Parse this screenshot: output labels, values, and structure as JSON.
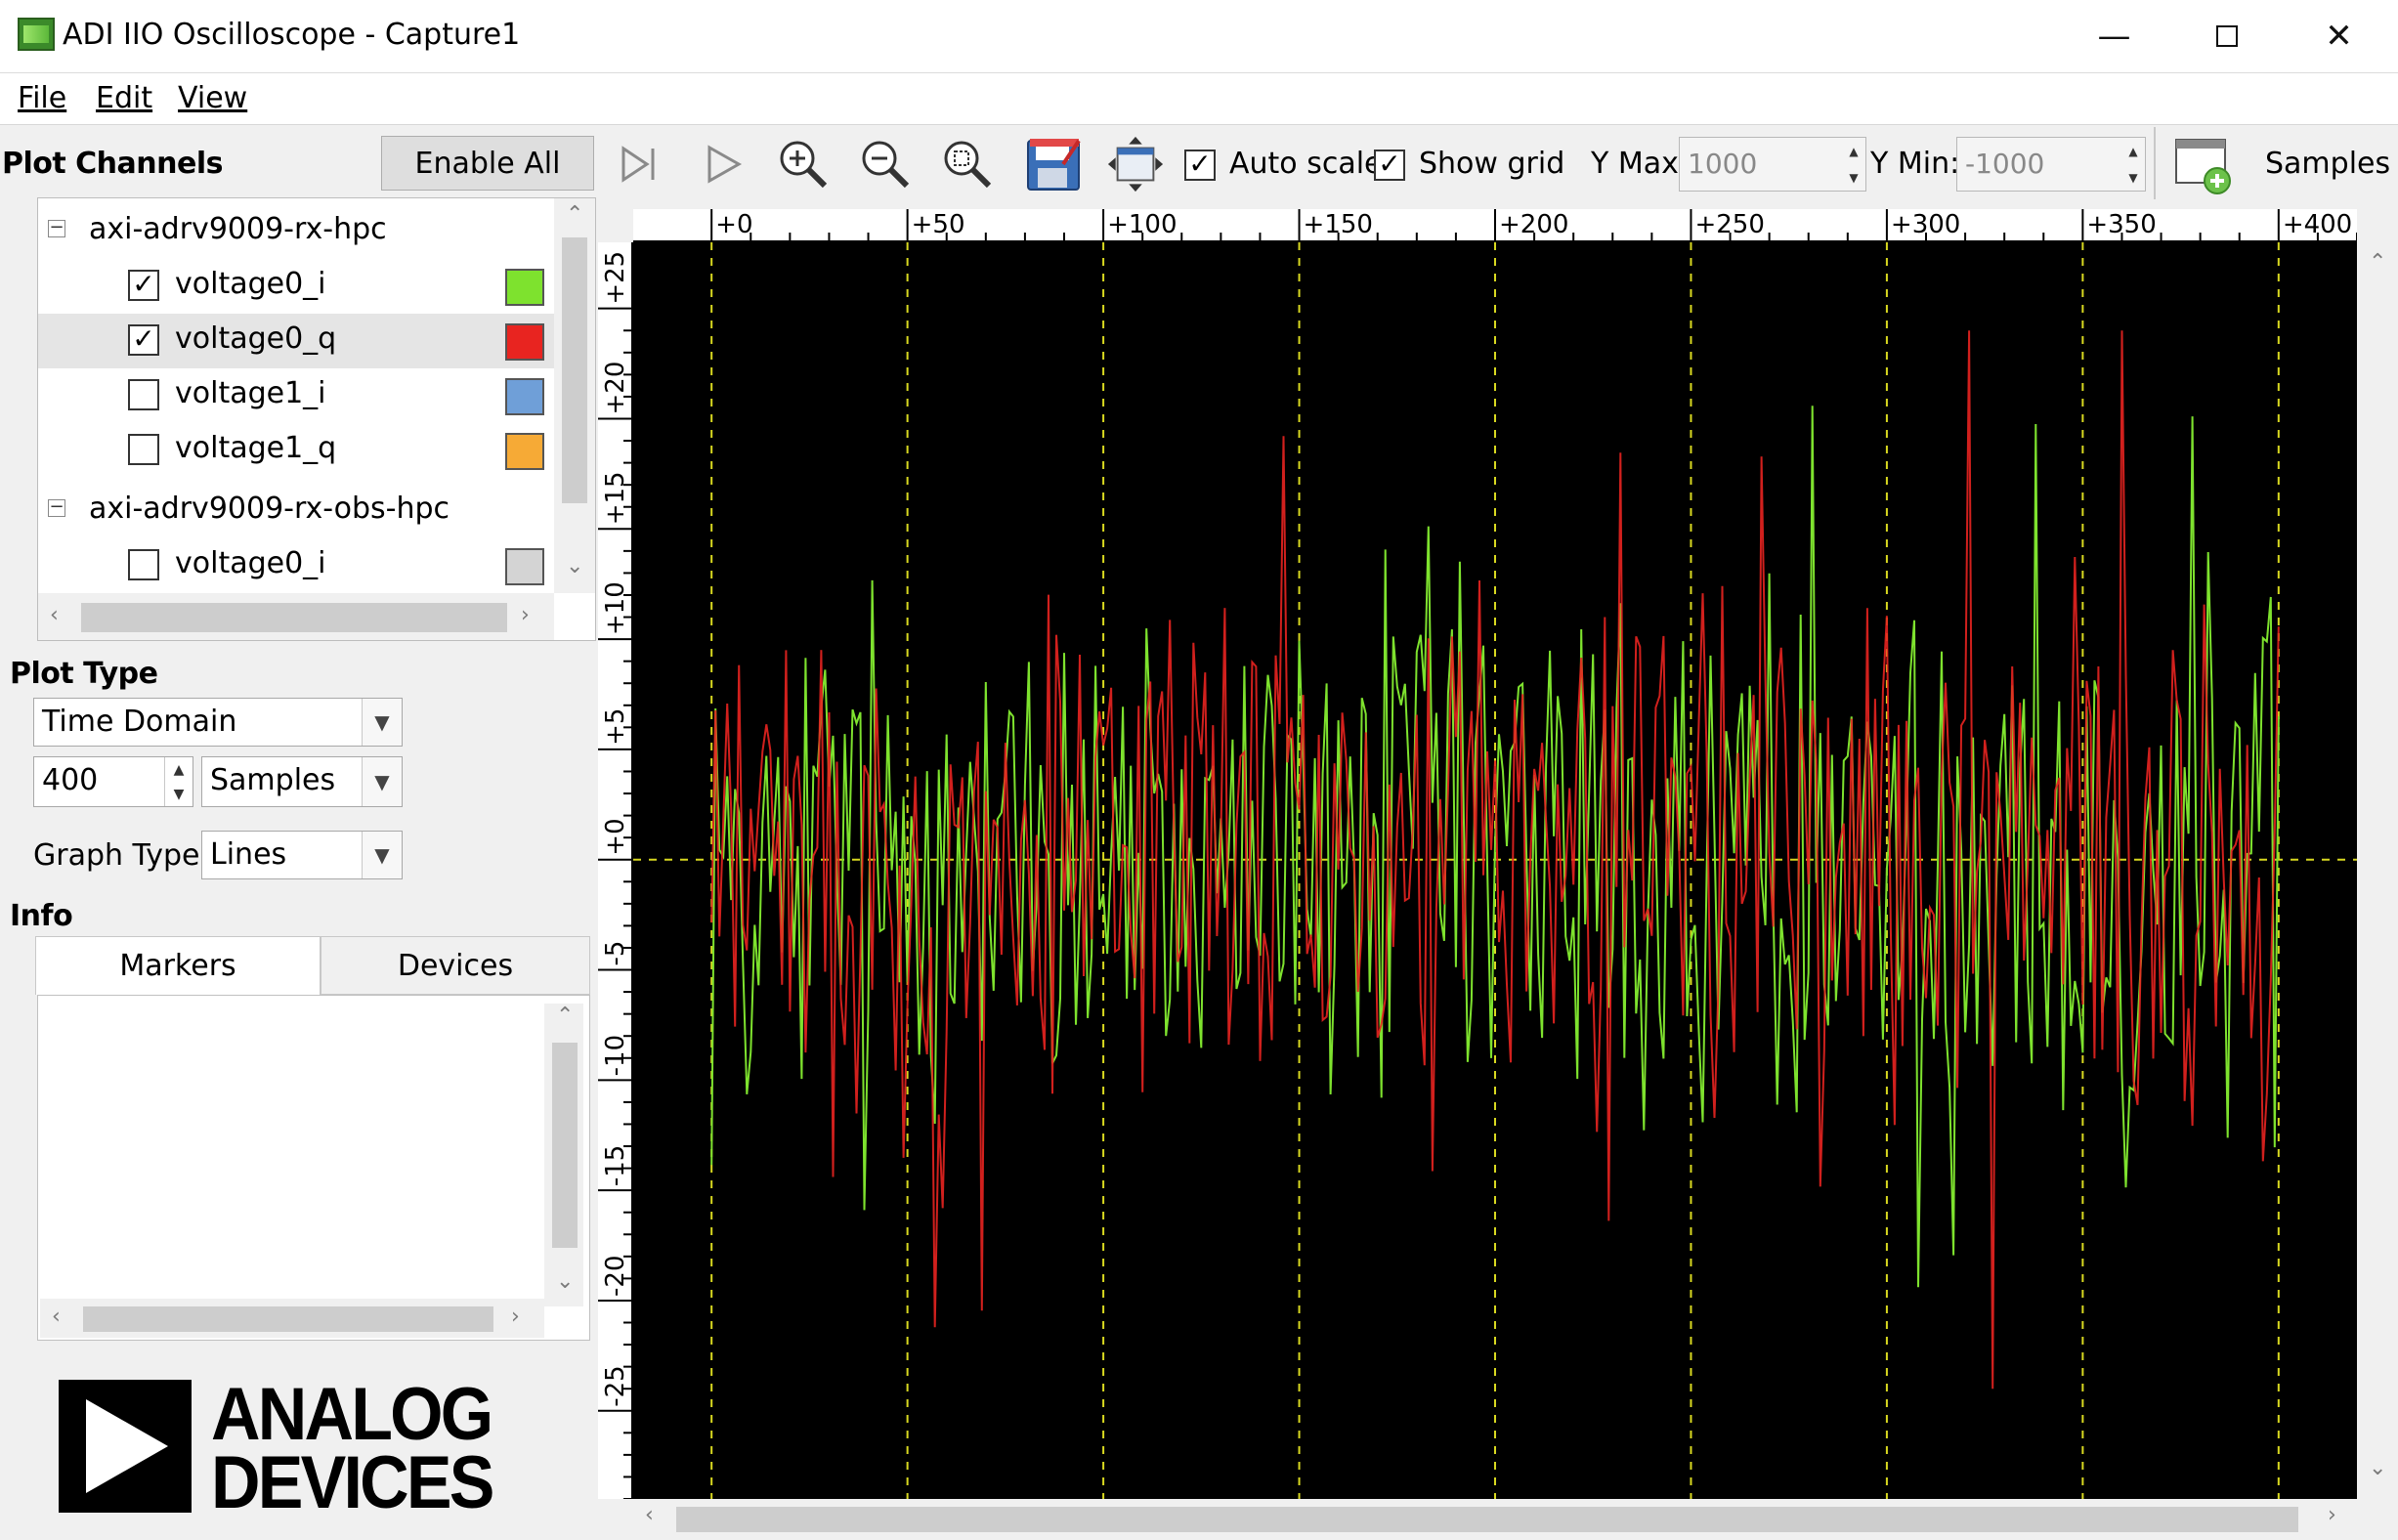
{
  "window": {
    "title": "ADI IIO Oscilloscope - Capture1"
  },
  "menu": {
    "file": "File",
    "edit": "Edit",
    "view": "View"
  },
  "left_panel": {
    "plot_channels_label": "Plot Channels",
    "enable_all_label": "Enable All",
    "devices": [
      {
        "name": "axi-adrv9009-rx-hpc",
        "channels": [
          {
            "name": "voltage0_i",
            "checked": true,
            "color": "#7ee22e"
          },
          {
            "name": "voltage0_q",
            "checked": true,
            "color": "#e82420"
          },
          {
            "name": "voltage1_i",
            "checked": false,
            "color": "#6f9fd8"
          },
          {
            "name": "voltage1_q",
            "checked": false,
            "color": "#f6aa36"
          }
        ]
      },
      {
        "name": "axi-adrv9009-rx-obs-hpc",
        "channels": [
          {
            "name": "voltage0_i",
            "checked": false,
            "color": "#d4d4d4"
          }
        ]
      }
    ],
    "plot_type_label": "Plot Type",
    "plot_type_value": "Time Domain",
    "sample_count": "400",
    "sample_unit": "Samples",
    "graph_type_label": "Graph Type:",
    "graph_type_value": "Lines",
    "info_label": "Info",
    "tabs": [
      "Markers",
      "Devices"
    ],
    "logo_line1": "ANALOG",
    "logo_line2": "DEVICES"
  },
  "toolbar": {
    "auto_scale_label": "Auto scale",
    "auto_scale_checked": true,
    "show_grid_label": "Show grid",
    "show_grid_checked": true,
    "ymax_label": "Y Max:",
    "ymax_value": "1000",
    "ymin_label": "Y Min:",
    "ymin_value": "-1000",
    "samples_label": "Samples",
    "icons": [
      "step-icon",
      "play-icon",
      "zoom-in-icon",
      "zoom-out-icon",
      "zoom-fit-icon",
      "save-icon",
      "fullscreen-icon",
      "add-plot-icon"
    ]
  },
  "chart_data": {
    "type": "line",
    "x_ticks": [
      "+0",
      "+50",
      "+100",
      "+150",
      "+200",
      "+250",
      "+300",
      "+350",
      "+400"
    ],
    "y_ticks": [
      "+25",
      "+20",
      "+15",
      "+10",
      "+5",
      "+0",
      "-5",
      "-10",
      "-15",
      "-20",
      "-25"
    ],
    "xlim": [
      -20,
      420
    ],
    "ylim": [
      -29,
      28
    ],
    "grid": true,
    "series": [
      {
        "name": "voltage0_i",
        "color": "#7ee22e",
        "n": 400,
        "amplitude": 9,
        "peak": 26
      },
      {
        "name": "voltage0_q",
        "color": "#e82420",
        "n": 400,
        "amplitude": 9,
        "peak": 24
      }
    ]
  }
}
